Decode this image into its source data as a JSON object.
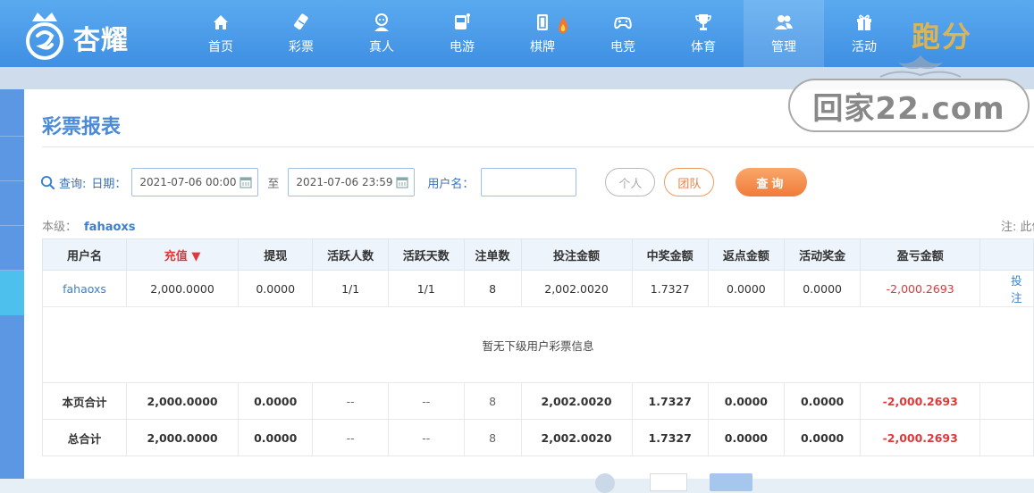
{
  "brand": {
    "name": "杏耀"
  },
  "nav": [
    {
      "label": "首页",
      "icon": "home-icon"
    },
    {
      "label": "彩票",
      "icon": "ticket-icon"
    },
    {
      "label": "真人",
      "icon": "dealer-icon"
    },
    {
      "label": "电游",
      "icon": "slot-machine-icon"
    },
    {
      "label": "棋牌",
      "icon": "mahjong-icon"
    },
    {
      "label": "电竞",
      "icon": "gamepad-icon"
    },
    {
      "label": "体育",
      "icon": "trophy-icon"
    },
    {
      "label": "管理",
      "icon": "users-icon"
    },
    {
      "label": "活动",
      "icon": "gift-icon"
    }
  ],
  "banner_text": "跑分",
  "watermark": "回家22.com",
  "page": {
    "title": "彩票报表"
  },
  "query": {
    "label": "查询:",
    "date_label": "日期：",
    "start_date": "2021-07-06 00:00",
    "to": "至",
    "end_date": "2021-07-06 23:59",
    "username_label": "用户名：",
    "username_value": "",
    "btn_person": "个人",
    "btn_team": "团队",
    "btn_query": "查询"
  },
  "level": {
    "label": "本级：",
    "user": "fahaoxs"
  },
  "note": "注: 此体",
  "colors": {
    "accent": "#4a8ad8",
    "nav_bg": "#4a9ae8",
    "loss": "#e0393a",
    "query_btn": "#f07b3a"
  },
  "table": {
    "headers": [
      "用户名",
      "充值",
      "提现",
      "活跃人数",
      "活跃天数",
      "注单数",
      "投注金额",
      "中奖金额",
      "返点金额",
      "活动奖金",
      "盈亏金额",
      ""
    ],
    "sorted_column": "充值",
    "row": [
      "fahaoxs",
      "2,000.0000",
      "0.0000",
      "1/1",
      "1/1",
      "8",
      "2,002.0020",
      "1.7327",
      "0.0000",
      "0.0000",
      "-2,000.2693",
      "投注"
    ],
    "empty_message": "暂无下级用户彩票信息",
    "page_total": [
      "本页合计",
      "2,000.0000",
      "0.0000",
      "--",
      "--",
      "8",
      "2,002.0020",
      "1.7327",
      "0.0000",
      "0.0000",
      "-2,000.2693",
      ""
    ],
    "grand_total": [
      "总合计",
      "2,000.0000",
      "0.0000",
      "--",
      "--",
      "8",
      "2,002.0020",
      "1.7327",
      "0.0000",
      "0.0000",
      "-2,000.2693",
      ""
    ]
  }
}
